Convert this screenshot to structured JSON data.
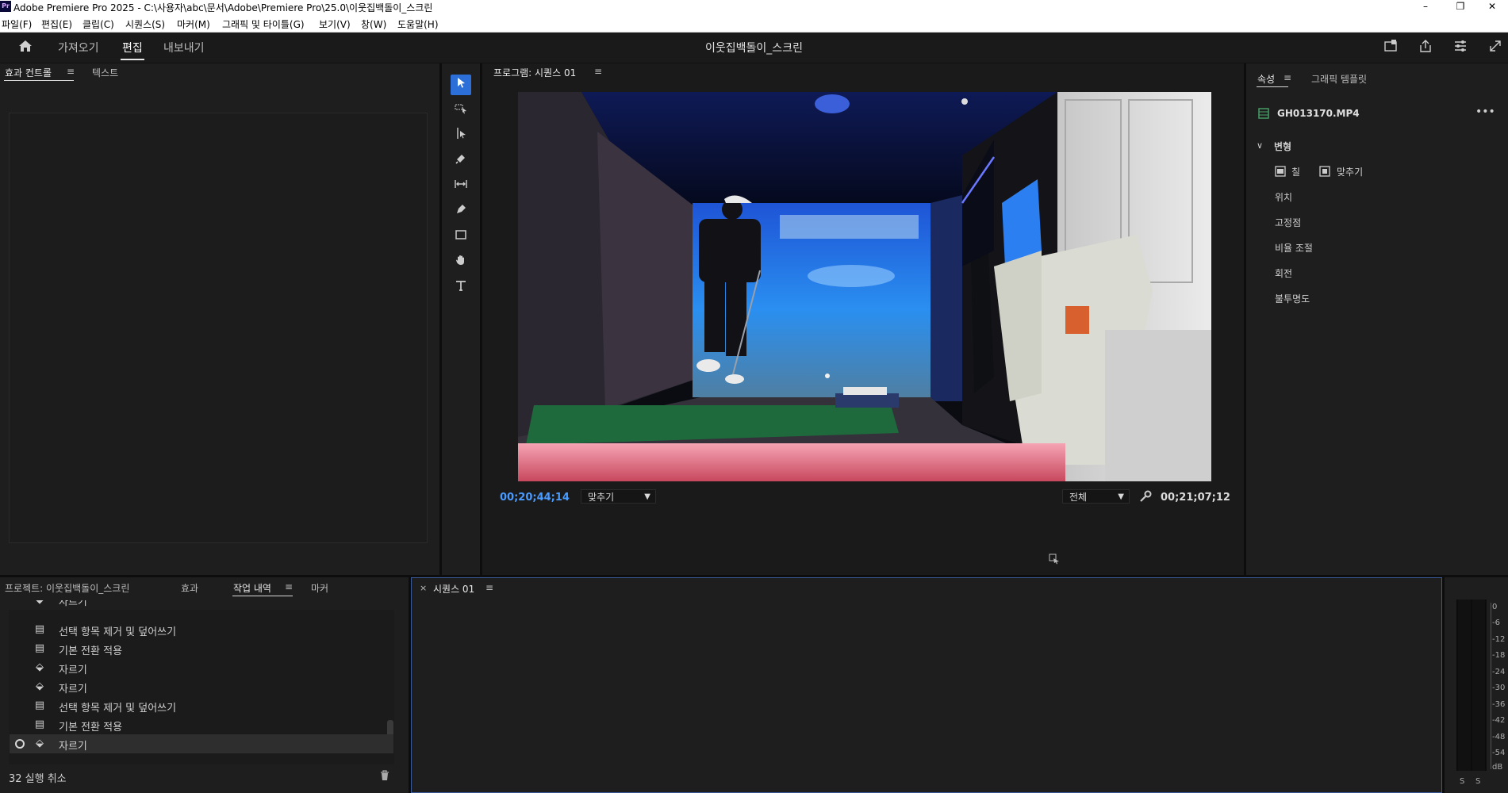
{
  "window": {
    "app_logo": "Pr",
    "title": "Adobe Premiere Pro 2025 - C:\\사용자\\abc\\문서\\Adobe\\Premiere Pro\\25.0\\이웃집백돌이_스크린",
    "minimize": "–",
    "restore": "❐",
    "close": "✕"
  },
  "menu": [
    "파일(F)",
    "편집(E)",
    "클립(C)",
    "시퀀스(S)",
    "마커(M)",
    "그래픽 및 타이틀(G)",
    "보기(V)",
    "창(W)",
    "도움말(H)"
  ],
  "header": {
    "tabs": [
      "가져오기",
      "편집",
      "내보내기"
    ],
    "active_tab": "편집",
    "project_title": "이웃집백돌이_스크린",
    "icons": [
      "quick-export-icon",
      "share-icon",
      "workspaces-icon",
      "fullscreen-icon"
    ]
  },
  "effect_controls_panel": {
    "tabs": [
      "효과 컨트롤",
      "텍스트"
    ],
    "menu_icon": "≡"
  },
  "tools": [
    "selection-tool-icon",
    "track-select-tool-icon",
    "ripple-edit-tool-icon",
    "razor-tool-icon",
    "slip-tool-icon",
    "pen-tool-icon",
    "rectangle-tool-icon",
    "hand-tool-icon",
    "type-tool-icon"
  ],
  "program_monitor": {
    "title": "프로그램: 시퀀스 01",
    "menu_icon": "≡",
    "current_timecode": "00;20;44;14",
    "fit_select": "맞추기",
    "quality_select": "전체",
    "duration_timecode": "00;21;07;12"
  },
  "properties_panel": {
    "tabs": [
      "속성",
      "그래픽 템플릿"
    ],
    "menu_icon": "≡",
    "clip_name": "GH013170.MP4",
    "more_icon": "•••",
    "section": "변형",
    "fill_label": "칠",
    "fit_label": "맞추기",
    "rows": [
      "위치",
      "고정점",
      "비율 조절",
      "회전",
      "불투명도"
    ]
  },
  "history_panel": {
    "tabs": [
      "프로젝트: 이웃집백돌이_스크린",
      "효과",
      "작업 내역",
      "마커"
    ],
    "active_tab": "작업 내역",
    "menu_icon": "≡",
    "items": [
      {
        "icon": "razor",
        "label": "자르기"
      },
      {
        "icon": "panel",
        "label": "선택 항목 제거 및 덮어쓰기"
      },
      {
        "icon": "panel",
        "label": "기본 전환 적용"
      },
      {
        "icon": "razor",
        "label": "자르기"
      },
      {
        "icon": "razor",
        "label": "자르기"
      },
      {
        "icon": "panel",
        "label": "선택 항목 제거 및 덮어쓰기"
      },
      {
        "icon": "panel",
        "label": "기본 전환 적용"
      },
      {
        "icon": "razor",
        "label": "자르기"
      }
    ],
    "selected_index": 7,
    "undo_count_text": "32 실행 취소"
  },
  "timeline": {
    "close_icon": "×",
    "tab": "시퀀스 01",
    "menu_icon": "≡"
  },
  "audio_meter": {
    "labels": [
      "0",
      "-6",
      "-12",
      "-18",
      "-24",
      "-30",
      "-36",
      "-42",
      "-48",
      "-54",
      "dB"
    ],
    "solo_labels": [
      "S",
      "S"
    ]
  },
  "colors": {
    "accent": "#2d6fd8",
    "timecode": "#4a9bff",
    "panel_bg": "#1e1e1e"
  }
}
